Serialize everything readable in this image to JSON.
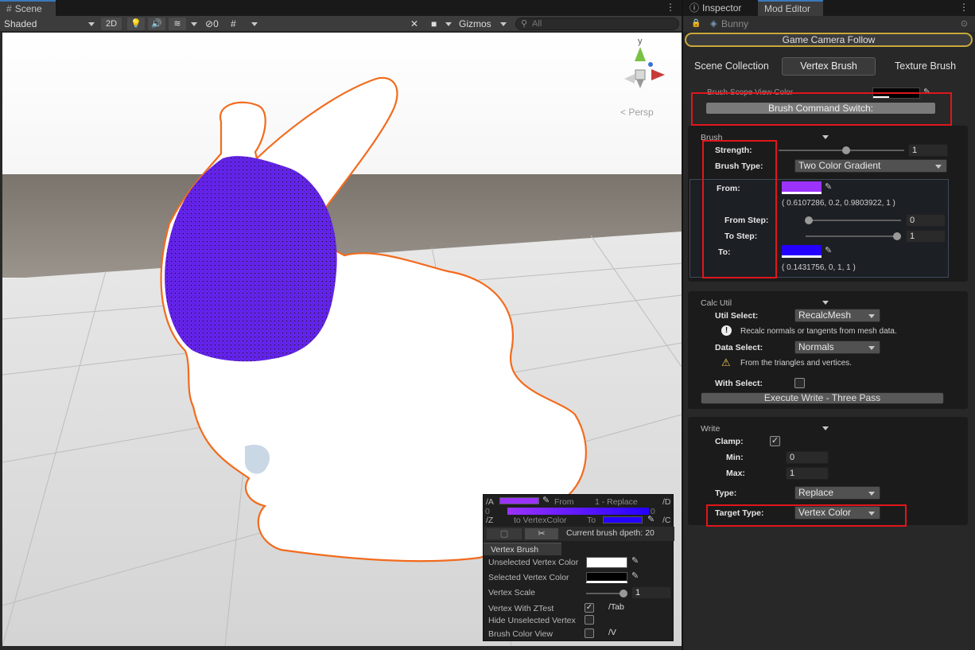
{
  "scene": {
    "tab_label": "Scene",
    "shading_mode": "Shaded",
    "btn_2d": "2D",
    "hidden_count": "0",
    "gizmos_label": "Gizmos",
    "search_placeholder": "All",
    "persp_label": "< Persp",
    "gizmo_axis_y": "y"
  },
  "overlay": {
    "label_a": "/A",
    "label_d": "/D",
    "label_z": "/Z",
    "label_c": "/C",
    "from_label": "From",
    "replace_label": "1 - Replace",
    "zero_left": "0",
    "zero_right": "0",
    "to_vertex_color": "to VertexColor",
    "to_label": "To",
    "brush_depth": "Current brush dpeth:  20",
    "tab_label": "Vertex Brush",
    "unselected_color_label": "Unselected Vertex Color",
    "selected_color_label": "Selected Vertex Color",
    "vertex_scale_label": "Vertex Scale",
    "vertex_scale_value": "1",
    "ztest_label": "Vertex With ZTest",
    "ztest_shortcut": "/Tab",
    "hide_unselected_label": "Hide Unselected Vertex",
    "brush_color_view_label": "Brush Color View",
    "brush_color_view_shortcut": "/V"
  },
  "inspector": {
    "tab_inspector": "Inspector",
    "tab_mod_editor": "Mod Editor",
    "object_name": "Bunny",
    "game_camera_follow": "Game Camera Follow",
    "tabs": [
      "Scene Collection",
      "Vertex Brush",
      "Texture Brush"
    ],
    "brush_scope_view_color": "Brush Scope View Color",
    "brush_command_switch": "Brush Command Switch:",
    "brush": {
      "header": "Brush",
      "strength_label": "Strength:",
      "strength_value": "1",
      "brush_type_label": "Brush Type:",
      "brush_type_value": "Two Color Gradient",
      "from_label": "From:",
      "from_rgba": "( 0.6107286, 0.2, 0.9803922, 1 )",
      "from_step_label": "From Step:",
      "from_step_value": "0",
      "to_step_label": "To Step:",
      "to_step_value": "1",
      "to_label": "To:",
      "to_rgba": "( 0.1431756, 0, 1, 1 )"
    },
    "calc_util": {
      "header": "Calc Util",
      "util_select_label": "Util Select:",
      "util_select_value": "RecalcMesh",
      "util_info": "Recalc normals or tangents from mesh data.",
      "data_select_label": "Data Select:",
      "data_select_value": "Normals",
      "data_warning": "From the triangles and vertices.",
      "with_select_label": "With Select:",
      "execute_button": "Execute Write - Three Pass"
    },
    "write": {
      "header": "Write",
      "clamp_label": "Clamp:",
      "min_label": "Min:",
      "min_value": "0",
      "max_label": "Max:",
      "max_value": "1",
      "type_label": "Type:",
      "type_value": "Replace",
      "target_type_label": "Target Type:",
      "target_type_value": "Vertex Color"
    }
  },
  "colors": {
    "from_color": "#9b33fa",
    "to_color": "#2400ff",
    "highlight_red": "#e0161b",
    "selection_outline": "#f26b1d"
  }
}
